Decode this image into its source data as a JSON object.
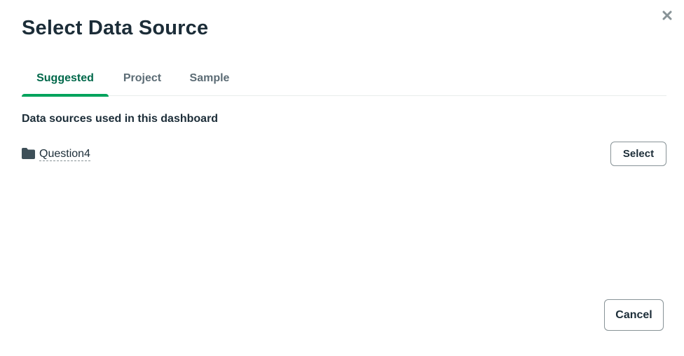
{
  "modal": {
    "title": "Select Data Source",
    "close_icon": "close-icon"
  },
  "tabs": [
    {
      "label": "Suggested",
      "active": true
    },
    {
      "label": "Project",
      "active": false
    },
    {
      "label": "Sample",
      "active": false
    }
  ],
  "suggested": {
    "heading": "Data sources used in this dashboard",
    "sources": [
      {
        "icon": "folder-icon",
        "name": "Question4",
        "button_label": "Select"
      }
    ]
  },
  "footer": {
    "cancel_label": "Cancel"
  },
  "colors": {
    "accent": "#00a35c",
    "accent_text": "#00684a",
    "text": "#1c2d38",
    "muted": "#5c6c75"
  }
}
